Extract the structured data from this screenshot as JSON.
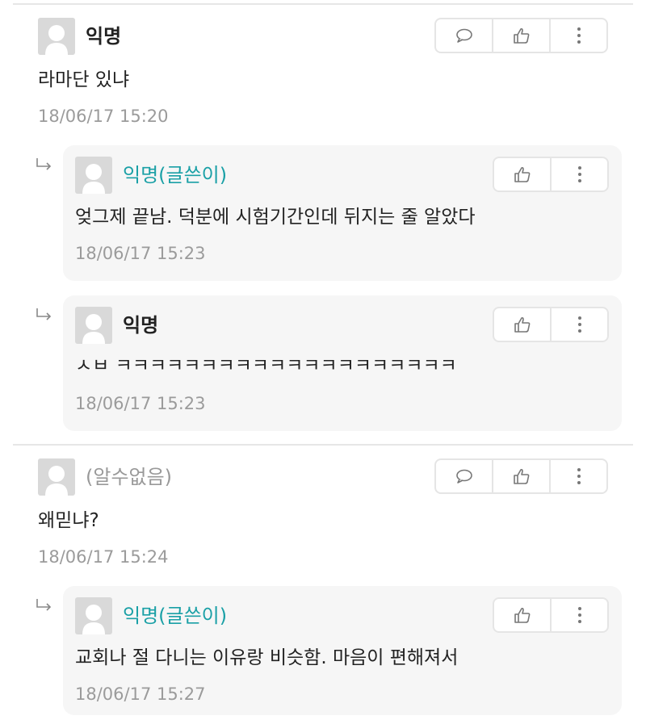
{
  "comments": [
    {
      "author": "익명",
      "text": "라마단 있냐",
      "time": "18/06/17 15:20",
      "replies": [
        {
          "author": "익명(글쓴이)",
          "text": "엊그제 끝남. 덕분에 시험기간인데 뒤지는 줄 알았다",
          "time": "18/06/17 15:23"
        },
        {
          "author": "익명",
          "text": "ㅅㅂ ㅋㅋㅋㅋㅋㅋㅋㅋㅋㅋㅋㅋㅋㅋㅋㅋㅋㅋㅋㅋ",
          "time": "18/06/17 15:23"
        }
      ]
    },
    {
      "author": "(알수없음)",
      "text": "왜믿냐?",
      "time": "18/06/17 15:24",
      "replies": [
        {
          "author": "익명(글쓴이)",
          "text": "교회나 절 다니는 이유랑 비슷함. 마음이 편해져서",
          "time": "18/06/17 15:27"
        }
      ]
    }
  ],
  "icons": {
    "comment": "speech-bubble-icon",
    "like": "thumbs-up-icon",
    "more": "vertical-ellipsis-icon",
    "reply": "reply-arrow-icon",
    "avatar": "default-avatar-icon"
  },
  "colors": {
    "op_author": "#1aa0a6",
    "unknown_author": "#999999",
    "timestamp": "#9b9b9b",
    "reply_background": "#f6f6f6"
  }
}
